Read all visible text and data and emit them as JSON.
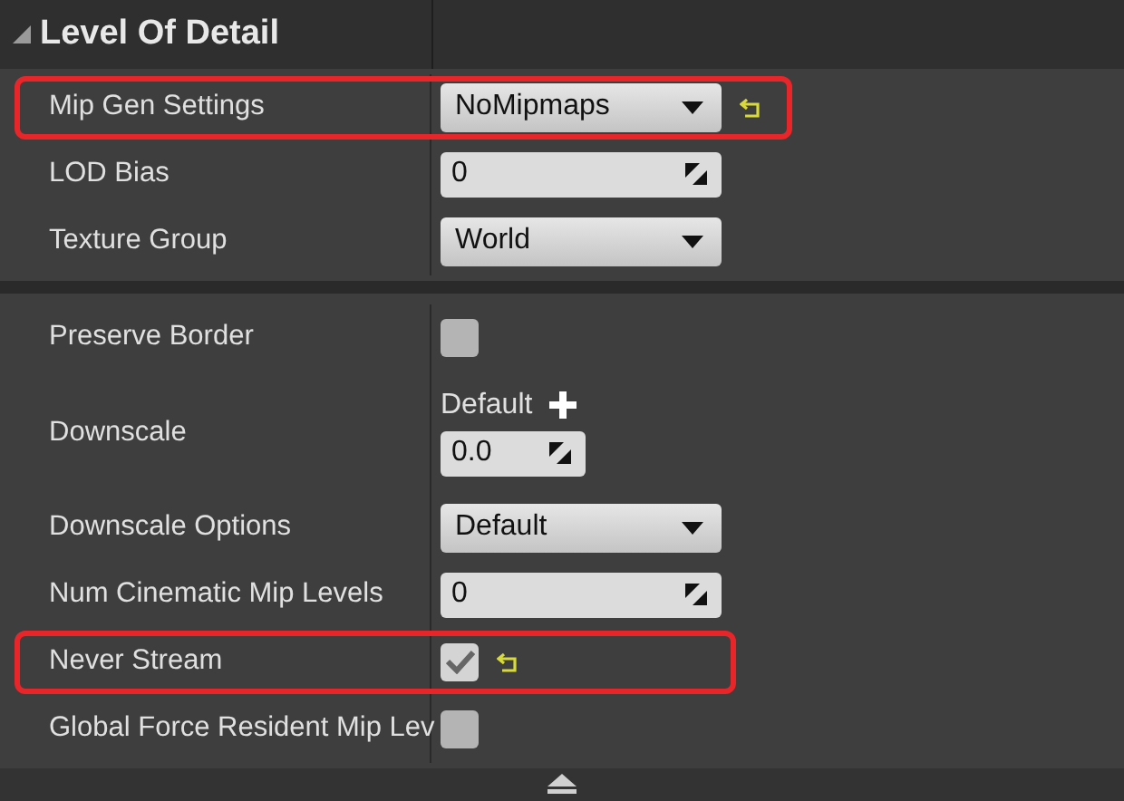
{
  "section": {
    "title": "Level Of Detail",
    "expanded": true
  },
  "groups": [
    {
      "rows": [
        {
          "label": "Mip Gen Settings",
          "kind": "dropdown",
          "value": "NoMipmaps",
          "highlighted": true,
          "reset": true
        },
        {
          "label": "LOD Bias",
          "kind": "number",
          "value": "0",
          "highlighted": false,
          "reset": false
        },
        {
          "label": "Texture Group",
          "kind": "dropdown",
          "value": "World",
          "highlighted": false,
          "reset": false
        }
      ]
    },
    {
      "rows": [
        {
          "label": "Preserve Border",
          "kind": "checkbox",
          "checked": false,
          "highlighted": false,
          "reset": false
        },
        {
          "label": "Downscale",
          "kind": "platform-number",
          "caption": "Default",
          "value": "0.0",
          "highlighted": false,
          "reset": false
        },
        {
          "label": "Downscale Options",
          "kind": "dropdown",
          "value": "Default",
          "highlighted": false,
          "reset": false
        },
        {
          "label": "Num Cinematic Mip Levels",
          "kind": "number",
          "value": "0",
          "highlighted": false,
          "reset": false
        },
        {
          "label": "Never Stream",
          "kind": "checkbox",
          "checked": true,
          "highlighted": true,
          "reset": true
        },
        {
          "label": "Global Force Resident Mip Lev",
          "kind": "checkbox",
          "checked": false,
          "highlighted": false,
          "reset": false
        }
      ]
    }
  ]
}
